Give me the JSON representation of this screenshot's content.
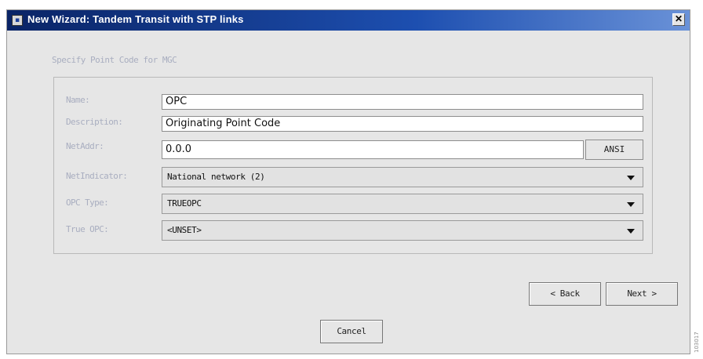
{
  "window": {
    "title": "New Wizard: Tandem Transit with STP links",
    "close_glyph": "✕"
  },
  "form": {
    "section_caption": "Specify Point Code for MGC",
    "fields": [
      {
        "label": "Name:",
        "value": "OPC"
      },
      {
        "label": "Description:",
        "value": "Originating Point Code"
      },
      {
        "label": "NetAddr:",
        "value": "0.0.0",
        "button_label": "ANSI"
      },
      {
        "label": "NetIndicator:",
        "value": "National network (2)"
      },
      {
        "label": "OPC Type:",
        "value": "TRUEOPC"
      },
      {
        "label": "True OPC:",
        "value": "<UNSET>"
      }
    ]
  },
  "buttons": {
    "back": "< Back",
    "next": "Next >",
    "cancel": "Cancel"
  },
  "side_mark": "103017",
  "icons": {
    "window": "window-icon",
    "close": "close-icon",
    "dropdown": "chevron-down-icon"
  }
}
